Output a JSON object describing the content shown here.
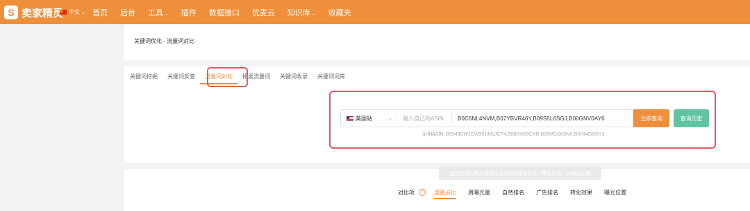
{
  "topbar": {
    "logo_mark": "S",
    "logo_text": "卖家精灵",
    "language": "中文",
    "nav": [
      {
        "label": "首页",
        "caret": ""
      },
      {
        "label": "后台",
        "caret": ""
      },
      {
        "label": "工具",
        "caret": "⌄"
      },
      {
        "label": "插件",
        "caret": ""
      },
      {
        "label": "数据接口",
        "caret": ""
      },
      {
        "label": "优麦云",
        "caret": ""
      },
      {
        "label": "知识库",
        "caret": "⌄"
      },
      {
        "label": "收藏夹",
        "caret": ""
      }
    ],
    "colors": {
      "bar": "#ef8f3b"
    }
  },
  "breadcrumb": "关键词优化 - 流量词对比",
  "tabs": [
    {
      "label": "关键词挖掘",
      "active": false
    },
    {
      "label": "关键词反查",
      "active": false
    },
    {
      "label": "流量词对比",
      "active": true
    },
    {
      "label": "拓展流量词",
      "active": false
    },
    {
      "label": "关键词收录",
      "active": false
    },
    {
      "label": "关键词词库",
      "active": false
    }
  ],
  "search": {
    "station": "美国站",
    "asin_placeholder": "输入自己的ASIN",
    "asin_values": "B0C6NL4NVM,B07YBVR46Y,B09S5L6SGJ,B00GNV0AY6",
    "query_button": "立即查询",
    "history_button": "查询历史",
    "example_label": "示例ASIN:",
    "example_values": "B0949DWJCV,B014INJCT4,B0BRN58CXR,B09MCKK9NX,B0744DM3Y3"
  },
  "tooltip": "蓝色竖线代表关键词在该时段的搜索流量（曝光位置）和曝光位置",
  "compare": {
    "label": "对比项",
    "help_icon": "?",
    "items": [
      {
        "label": "流量占比",
        "active": true
      },
      {
        "label": "周曝光量",
        "active": false
      },
      {
        "label": "自然排名",
        "active": false
      },
      {
        "label": "广告排名",
        "active": false
      },
      {
        "label": "转化效果",
        "active": false
      },
      {
        "label": "曝光位置",
        "active": false
      }
    ]
  },
  "highlight_color": "#e05a63"
}
